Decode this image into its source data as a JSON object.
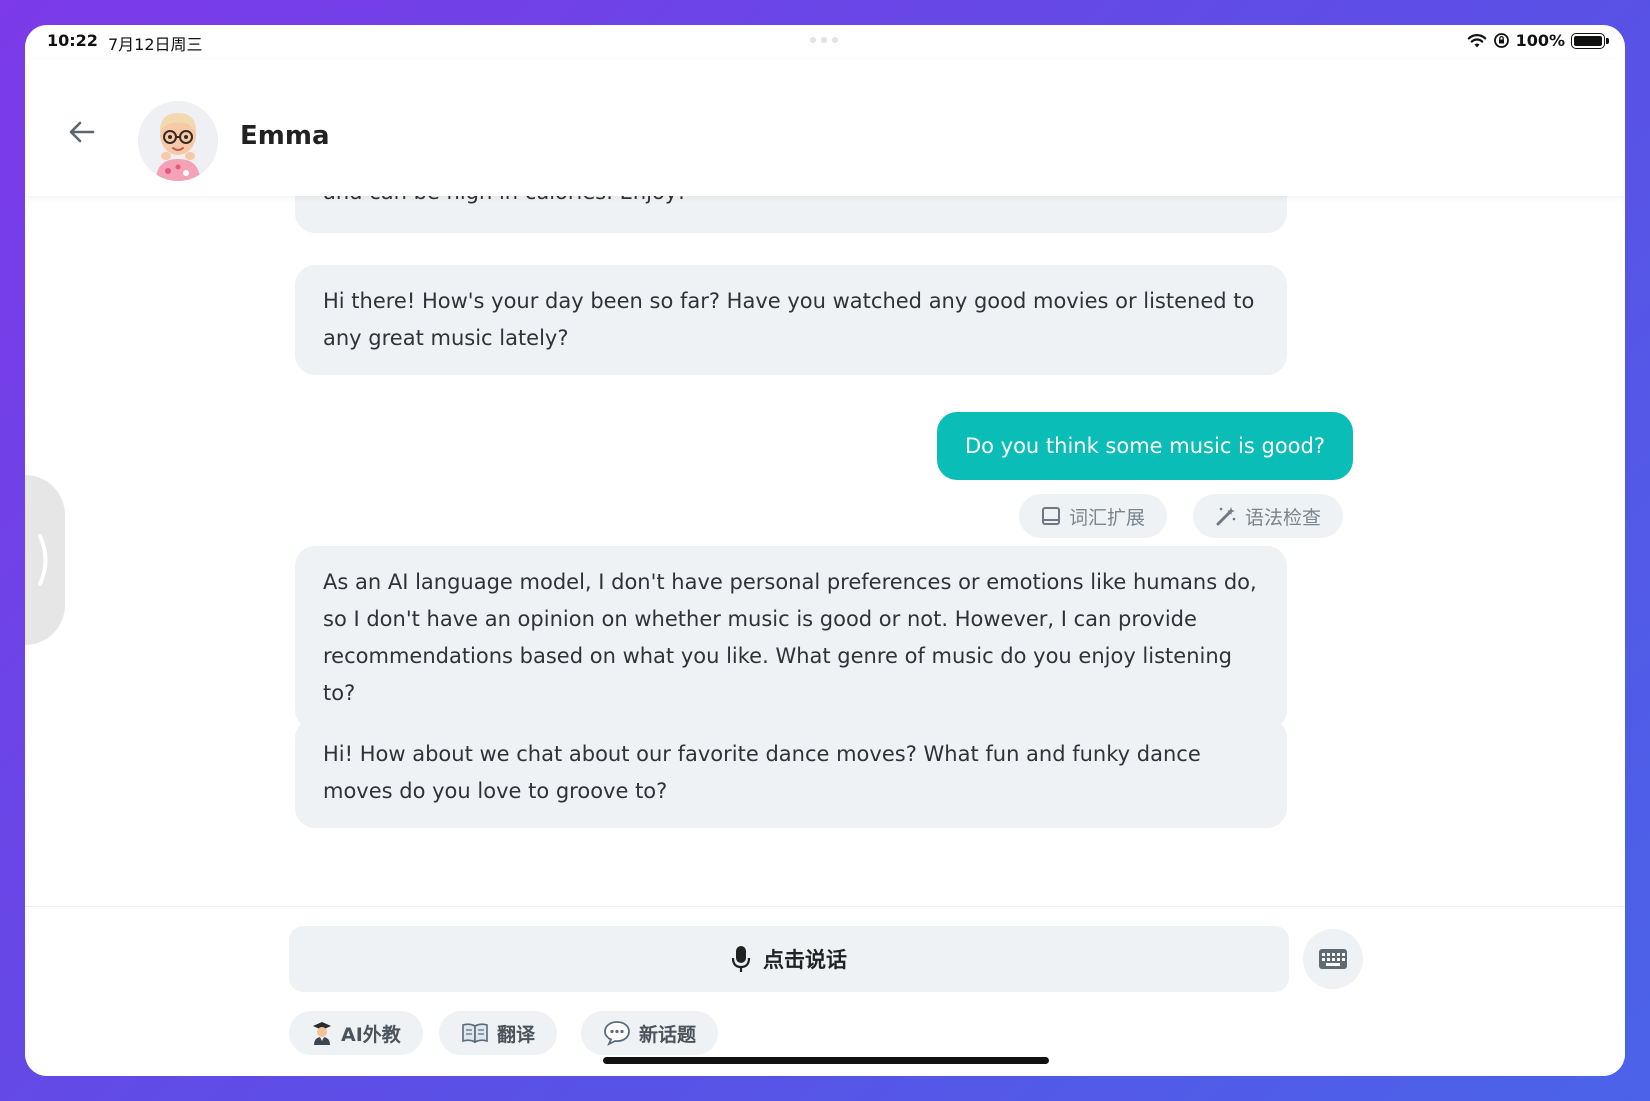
{
  "status_bar": {
    "time": "10:22",
    "date": "7月12日周三",
    "battery": "100%"
  },
  "header": {
    "title": "Emma"
  },
  "messages": [
    {
      "role": "ai",
      "text": "and can be high in calories. Enjoy!"
    },
    {
      "role": "ai",
      "text": "Hi there! How's your day been so far? Have you watched any good movies or listened to any great music lately?"
    },
    {
      "role": "user",
      "text": "Do you think some music is good?"
    },
    {
      "role": "ai",
      "text": "As an AI language model, I don't have personal preferences or emotions like humans do, so I don't have an opinion on whether music is good or not. However, I can provide recommendations based on what you like. What genre of music do you enjoy listening to?"
    },
    {
      "role": "ai",
      "text": "Hi! How about we chat about our favorite dance moves? What fun and funky dance moves do you love to groove to?"
    }
  ],
  "message_actions": {
    "vocab": "词汇扩展",
    "grammar": "语法检查"
  },
  "input": {
    "talk_label": "点击说话"
  },
  "tools": [
    {
      "label": "AI外教",
      "icon": "teacher-icon"
    },
    {
      "label": "翻译",
      "icon": "book-icon"
    },
    {
      "label": "新话题",
      "icon": "speech-bubble-icon"
    }
  ],
  "colors": {
    "user_bubble": "#0bbdb7",
    "ai_bubble": "#eef2f5",
    "background_gradient_start": "#7c3ae8",
    "background_gradient_end": "#4b63e8"
  }
}
